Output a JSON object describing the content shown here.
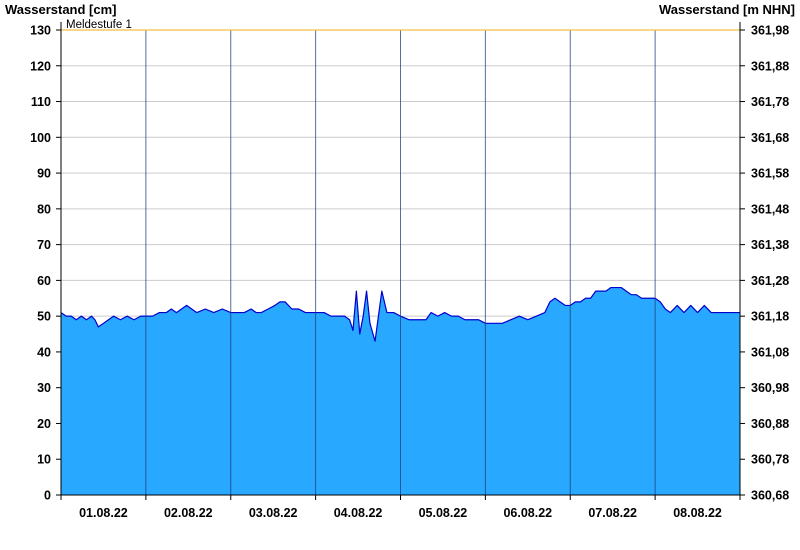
{
  "chart_data": {
    "type": "area",
    "left_axis_title": "Wasserstand [cm]",
    "right_axis_title": "Wasserstand [m NHN]",
    "y_left": {
      "min": 0,
      "max": 130,
      "ticks": [
        "0",
        "10",
        "20",
        "30",
        "40",
        "50",
        "60",
        "70",
        "80",
        "90",
        "100",
        "110",
        "120",
        "130"
      ]
    },
    "y_right": {
      "min": 360.68,
      "max": 361.98,
      "ticks": [
        "360,68",
        "360,78",
        "360,88",
        "360,98",
        "361,08",
        "361,18",
        "361,28",
        "361,38",
        "361,48",
        "361,58",
        "361,68",
        "361,78",
        "361,88",
        "361,98"
      ]
    },
    "x_axis": {
      "start": "2022-08-01",
      "days": 8,
      "tick_labels": [
        "01.08.22",
        "02.08.22",
        "03.08.22",
        "04.08.22",
        "05.08.22",
        "06.08.22",
        "07.08.22",
        "08.08.22"
      ]
    },
    "threshold": {
      "label": "Meldestufe 1",
      "value": 130,
      "color": "#f0c040"
    },
    "colors": {
      "fill": "#29a8ff",
      "line": "#0000cc",
      "grid": "#cccccc"
    },
    "series": [
      {
        "x_unit": "day",
        "points": [
          [
            0.0,
            51
          ],
          [
            0.06,
            50
          ],
          [
            0.12,
            50
          ],
          [
            0.18,
            49
          ],
          [
            0.24,
            50
          ],
          [
            0.3,
            49
          ],
          [
            0.36,
            50
          ],
          [
            0.4,
            49
          ],
          [
            0.44,
            47
          ],
          [
            0.5,
            48
          ],
          [
            0.56,
            49
          ],
          [
            0.62,
            50
          ],
          [
            0.7,
            49
          ],
          [
            0.78,
            50
          ],
          [
            0.86,
            49
          ],
          [
            0.94,
            50
          ],
          [
            1.0,
            50
          ],
          [
            1.08,
            50
          ],
          [
            1.16,
            51
          ],
          [
            1.24,
            51
          ],
          [
            1.3,
            52
          ],
          [
            1.36,
            51
          ],
          [
            1.42,
            52
          ],
          [
            1.48,
            53
          ],
          [
            1.54,
            52
          ],
          [
            1.6,
            51
          ],
          [
            1.7,
            52
          ],
          [
            1.8,
            51
          ],
          [
            1.9,
            52
          ],
          [
            2.0,
            51
          ],
          [
            2.08,
            51
          ],
          [
            2.16,
            51
          ],
          [
            2.24,
            52
          ],
          [
            2.3,
            51
          ],
          [
            2.36,
            51
          ],
          [
            2.44,
            52
          ],
          [
            2.52,
            53
          ],
          [
            2.58,
            54
          ],
          [
            2.64,
            54
          ],
          [
            2.72,
            52
          ],
          [
            2.8,
            52
          ],
          [
            2.88,
            51
          ],
          [
            2.96,
            51
          ],
          [
            3.0,
            51
          ],
          [
            3.1,
            51
          ],
          [
            3.18,
            50
          ],
          [
            3.26,
            50
          ],
          [
            3.34,
            50
          ],
          [
            3.4,
            49
          ],
          [
            3.44,
            46
          ],
          [
            3.48,
            57
          ],
          [
            3.52,
            45
          ],
          [
            3.56,
            50
          ],
          [
            3.6,
            57
          ],
          [
            3.64,
            48
          ],
          [
            3.7,
            43
          ],
          [
            3.74,
            50
          ],
          [
            3.78,
            57
          ],
          [
            3.84,
            51
          ],
          [
            3.92,
            51
          ],
          [
            4.0,
            50
          ],
          [
            4.1,
            49
          ],
          [
            4.2,
            49
          ],
          [
            4.3,
            49
          ],
          [
            4.36,
            51
          ],
          [
            4.44,
            50
          ],
          [
            4.52,
            51
          ],
          [
            4.6,
            50
          ],
          [
            4.68,
            50
          ],
          [
            4.76,
            49
          ],
          [
            4.84,
            49
          ],
          [
            4.92,
            49
          ],
          [
            5.0,
            48
          ],
          [
            5.1,
            48
          ],
          [
            5.2,
            48
          ],
          [
            5.3,
            49
          ],
          [
            5.4,
            50
          ],
          [
            5.5,
            49
          ],
          [
            5.6,
            50
          ],
          [
            5.7,
            51
          ],
          [
            5.76,
            54
          ],
          [
            5.82,
            55
          ],
          [
            5.88,
            54
          ],
          [
            5.94,
            53
          ],
          [
            6.0,
            53
          ],
          [
            6.06,
            54
          ],
          [
            6.12,
            54
          ],
          [
            6.18,
            55
          ],
          [
            6.24,
            55
          ],
          [
            6.3,
            57
          ],
          [
            6.36,
            57
          ],
          [
            6.42,
            57
          ],
          [
            6.48,
            58
          ],
          [
            6.54,
            58
          ],
          [
            6.6,
            58
          ],
          [
            6.66,
            57
          ],
          [
            6.72,
            56
          ],
          [
            6.78,
            56
          ],
          [
            6.84,
            55
          ],
          [
            6.92,
            55
          ],
          [
            7.0,
            55
          ],
          [
            7.06,
            54
          ],
          [
            7.12,
            52
          ],
          [
            7.18,
            51
          ],
          [
            7.26,
            53
          ],
          [
            7.34,
            51
          ],
          [
            7.42,
            53
          ],
          [
            7.5,
            51
          ],
          [
            7.58,
            53
          ],
          [
            7.66,
            51
          ],
          [
            7.74,
            51
          ],
          [
            7.82,
            51
          ],
          [
            7.9,
            51
          ],
          [
            8.0,
            51
          ]
        ]
      }
    ]
  }
}
